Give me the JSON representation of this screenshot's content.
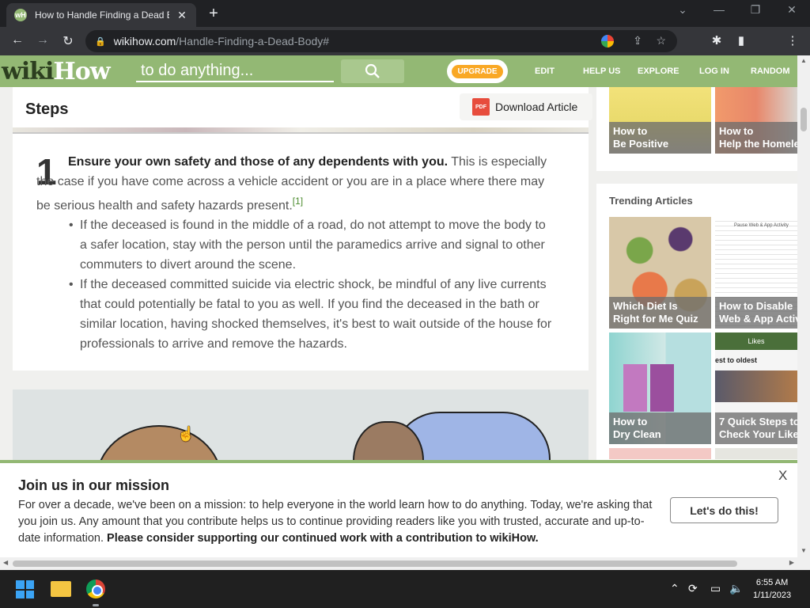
{
  "browser": {
    "tab_title": "How to Handle Finding a Dead Body",
    "tab_favicon": "wH",
    "url_domain": "wikihow.com",
    "url_path": "/Handle-Finding-a-Dead-Body#"
  },
  "header": {
    "logo_wiki": "wiki",
    "logo_how": "How",
    "search_placeholder": "to do anything...",
    "upgrade_label": "UPGRADE",
    "nav": [
      "EDIT",
      "HELP US",
      "EXPLORE",
      "LOG IN",
      "RANDOM"
    ]
  },
  "article": {
    "section_title": "Steps",
    "download_label": "Download Article",
    "pdf_label": "PDF",
    "step_number": "1",
    "step_bold": "Ensure your own safety and those of any dependents with you.",
    "step_text": " This is especially the case if you have come across a vehicle accident or you are in a place where there may be serious health and safety hazards present.",
    "step_ref": "[1]",
    "bullets": [
      "If the deceased is found in the middle of a road, do not attempt to move the body to a safer location, stay with the person until the paramedics arrive and signal to other commuters to divert around the scene.",
      "If the deceased committed suicide via electric shock, be mindful of any live currents that could potentially be fatal to you as well. If you find the deceased in the bath or similar location, having shocked themselves, it's best to wait outside of the house for professionals to arrive and remove the hazards."
    ]
  },
  "sidebar": {
    "related": [
      {
        "line1": "How to",
        "line2": "Be Positive"
      },
      {
        "line1": "How to",
        "line2": "Help the Homeless"
      }
    ],
    "trending_title": "Trending Articles",
    "trending": [
      {
        "line1": "Which Diet Is",
        "line2": "Right for Me Quiz"
      },
      {
        "line1": "How to Disable",
        "line2": "Web & App Activity for Your Google Account"
      },
      {
        "line1": "How to",
        "line2": "Dry Clean"
      },
      {
        "line1": "7 Quick Steps to",
        "line2": "Check Your Likes History on Instagram"
      }
    ],
    "thumb_texts": {
      "pause_web_app": "Pause Web & App Activity",
      "likes_header": "Likes",
      "newest_to_oldest": "est to oldest"
    }
  },
  "banner": {
    "title": "Join us in our mission",
    "text": "For over a decade, we've been on a mission: to help everyone in the world learn how to do anything. Today, we're asking that you join us. Any amount that you contribute helps us to continue providing readers like you with trusted, accurate and up-to-date information. ",
    "text_bold": "Please consider supporting our continued work with a contribution to wikiHow.",
    "button_label": "Let's do this!",
    "close_label": "X"
  },
  "taskbar": {
    "time": "6:55 AM",
    "date": "1/11/2023"
  },
  "colors": {
    "brand_green": "#93b874",
    "upgrade_orange": "#f9a825"
  }
}
